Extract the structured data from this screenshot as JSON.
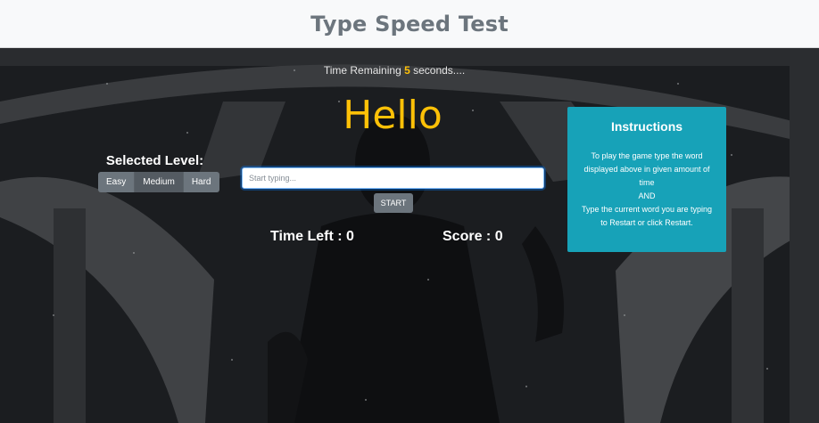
{
  "header": {
    "title": "Type Speed Test"
  },
  "status": {
    "prefix": "Time Remaining ",
    "seconds": "5",
    "suffix": " seconds...."
  },
  "game": {
    "current_word": "Hello",
    "level_label": "Selected Level:",
    "levels": [
      "Easy",
      "Medium",
      "Hard"
    ],
    "active_level": "Medium",
    "input_placeholder": "Start typing...",
    "input_value": "",
    "start_label": "START",
    "time_left_label": "Time Left : 0",
    "score_label": "Score : 0"
  },
  "instructions": {
    "title": "Instructions",
    "line1": "To play the game type the word displayed above in given amount of time",
    "line2": "AND",
    "line3": "Type the current word you are typing to Restart or click Restart."
  },
  "colors": {
    "accent": "#ffc107",
    "card": "#17a2b8",
    "button": "#6c757d",
    "navbar": "#f8f9fa"
  }
}
